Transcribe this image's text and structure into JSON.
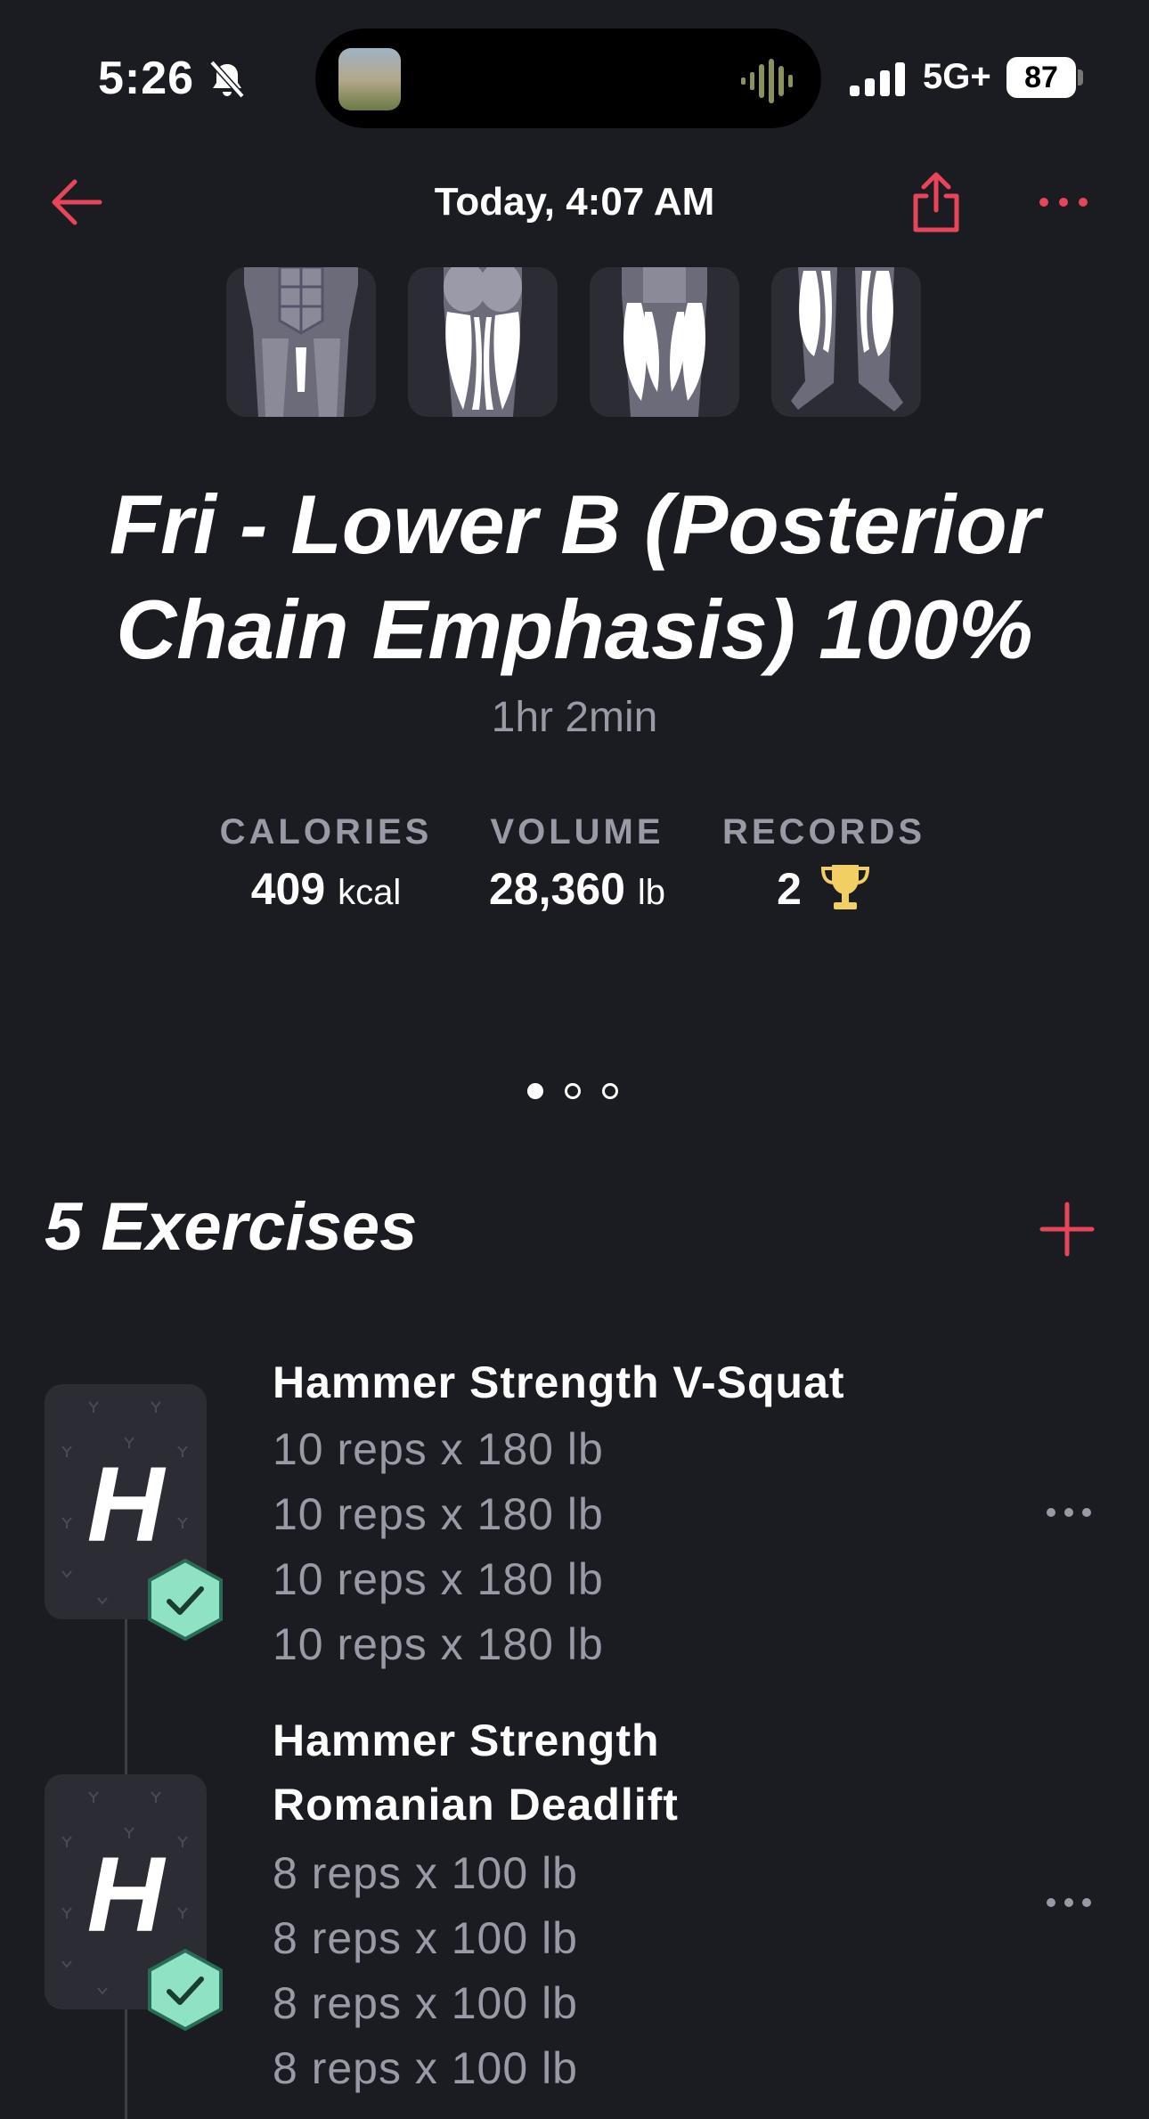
{
  "status_bar": {
    "time": "5:26",
    "network": "5G+",
    "battery": "87"
  },
  "nav": {
    "title": "Today, 4:07 AM",
    "back_icon": "arrow-left-icon",
    "share_icon": "share-icon",
    "more_icon": "ellipsis-icon"
  },
  "workout": {
    "title": "Fri - Lower B  (Posterior Chain Emphasis) 100%",
    "duration": "1hr 2min"
  },
  "stats": [
    {
      "label": "CALORIES",
      "value": "409",
      "unit": "kcal"
    },
    {
      "label": "VOLUME",
      "value": "28,360",
      "unit": "lb"
    },
    {
      "label": "RECORDS",
      "value": "2",
      "icon": "trophy-icon"
    }
  ],
  "pager": {
    "count": 3,
    "active": 0
  },
  "exercises_section": {
    "title": "5 Exercises"
  },
  "exercises": [
    {
      "letter": "H",
      "name": "Hammer Strength V-Squat",
      "sets": [
        "10 reps x 180 lb",
        "10 reps x 180 lb",
        "10 reps x 180 lb",
        "10 reps x 180 lb"
      ]
    },
    {
      "letter": "H",
      "name_line1": "Hammer Strength",
      "name_line2": "Romanian Deadlift",
      "sets": [
        "8 reps x 100 lb",
        "8 reps x 100 lb",
        "8 reps x 100 lb",
        "8 reps x 100 lb"
      ]
    }
  ],
  "colors": {
    "background": "#1b1b22",
    "accent": "#e8445a",
    "muted_text": "#9a9aa6",
    "card": "#2c2c35",
    "check": "#8fe3c4",
    "trophy": "#f2cf63"
  }
}
